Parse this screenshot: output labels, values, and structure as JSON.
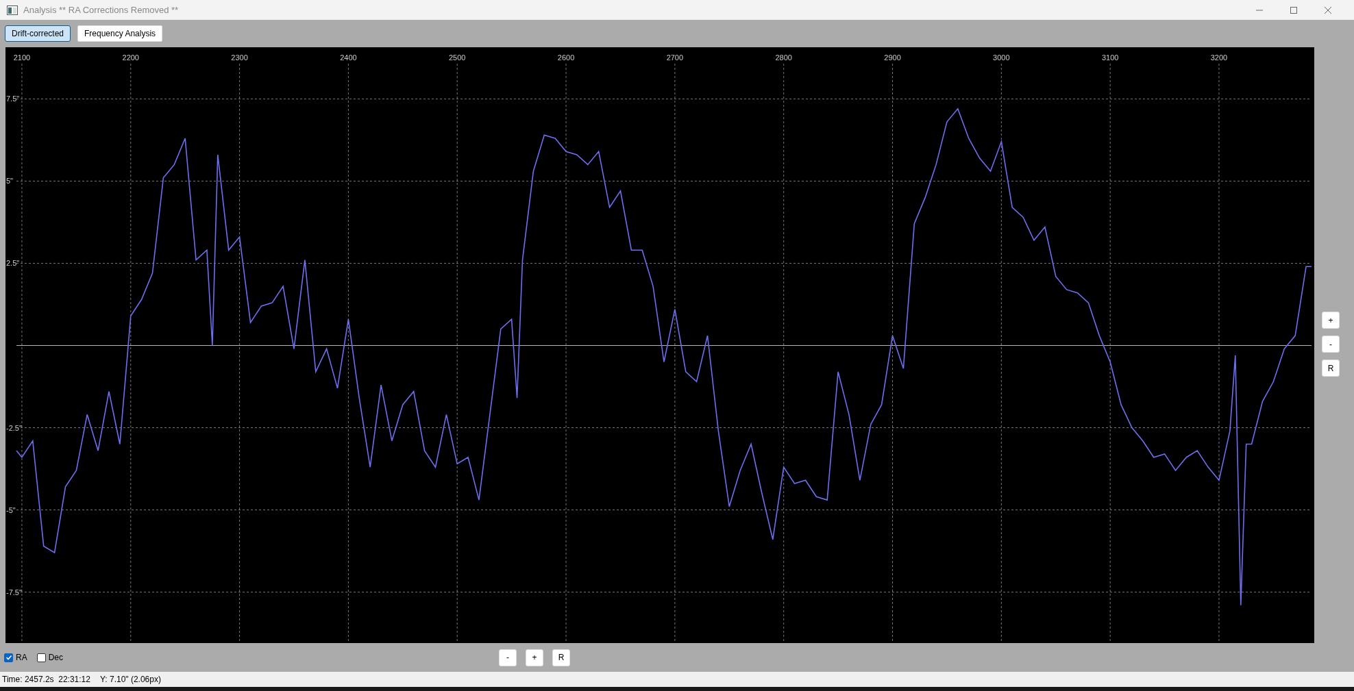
{
  "window": {
    "title": "Analysis ** RA Corrections Removed **"
  },
  "tabs": [
    {
      "label": "Drift-corrected",
      "selected": true
    },
    {
      "label": "Frequency Analysis",
      "selected": false
    }
  ],
  "chart": {
    "chart_data": {
      "type": "line",
      "grid": true,
      "xlim": [
        2095,
        3285
      ],
      "ylim": [
        -9.05,
        9.07
      ],
      "xticks": [
        2100,
        2200,
        2300,
        2400,
        2500,
        2600,
        2700,
        2800,
        2900,
        3000,
        3100,
        3200
      ],
      "yticks": [
        {
          "value": 7.5,
          "label": "7.5\""
        },
        {
          "value": 5,
          "label": "5\""
        },
        {
          "value": 2.5,
          "label": "2.5\""
        },
        {
          "value": -2.5,
          "label": "-2.5\""
        },
        {
          "value": -5,
          "label": "-5\""
        },
        {
          "value": -7.5,
          "label": "-7.5\""
        }
      ],
      "x": [
        2095,
        2100,
        2110,
        2120,
        2130,
        2140,
        2150,
        2160,
        2170,
        2180,
        2190,
        2200,
        2210,
        2220,
        2230,
        2240,
        2250,
        2260,
        2270,
        2275,
        2280,
        2290,
        2300,
        2310,
        2320,
        2330,
        2340,
        2350,
        2360,
        2370,
        2380,
        2390,
        2400,
        2410,
        2420,
        2430,
        2440,
        2450,
        2460,
        2470,
        2480,
        2490,
        2500,
        2510,
        2520,
        2530,
        2540,
        2550,
        2555,
        2560,
        2570,
        2580,
        2590,
        2600,
        2610,
        2620,
        2630,
        2640,
        2650,
        2660,
        2670,
        2680,
        2690,
        2700,
        2710,
        2720,
        2730,
        2740,
        2750,
        2760,
        2770,
        2780,
        2790,
        2800,
        2810,
        2820,
        2830,
        2840,
        2850,
        2860,
        2870,
        2880,
        2890,
        2900,
        2910,
        2920,
        2930,
        2940,
        2950,
        2960,
        2970,
        2980,
        2990,
        3000,
        3010,
        3020,
        3030,
        3040,
        3050,
        3060,
        3070,
        3080,
        3090,
        3100,
        3110,
        3120,
        3130,
        3140,
        3150,
        3160,
        3170,
        3180,
        3190,
        3200,
        3210,
        3215,
        3220,
        3225,
        3230,
        3240,
        3250,
        3260,
        3270,
        3280,
        3285
      ],
      "series": [
        {
          "color": "#6e6ef0",
          "values": [
            -3.2,
            -3.4,
            -2.9,
            -6.1,
            -6.3,
            -4.3,
            -3.8,
            -2.1,
            -3.2,
            -1.4,
            -3.0,
            0.9,
            1.4,
            2.2,
            5.1,
            5.5,
            6.3,
            2.6,
            2.9,
            0,
            5.8,
            2.9,
            3.3,
            0.7,
            1.2,
            1.3,
            1.8,
            -0.1,
            2.6,
            -0.8,
            -0.1,
            -1.3,
            0.8,
            -1.6,
            -3.7,
            -1.2,
            -2.9,
            -1.8,
            -1.4,
            -3.2,
            -3.7,
            -2.1,
            -3.6,
            -3.4,
            -4.7,
            -2.1,
            0.5,
            0.8,
            -1.6,
            2.6,
            5.3,
            6.4,
            6.3,
            5.9,
            5.8,
            5.5,
            5.9,
            4.2,
            4.7,
            2.9,
            2.9,
            1.8,
            -0.5,
            1.1,
            -0.8,
            -1.1,
            0.3,
            -2.6,
            -4.9,
            -3.8,
            -3.0,
            -4.5,
            -5.9,
            -3.7,
            -4.2,
            -4.1,
            -4.6,
            -4.7,
            -0.8,
            -2.1,
            -4.1,
            -2.4,
            -1.8,
            0.3,
            -0.7,
            3.7,
            4.5,
            5.5,
            6.8,
            7.2,
            6.3,
            5.7,
            5.3,
            6.2,
            4.2,
            3.9,
            3.2,
            3.6,
            2.1,
            1.7,
            1.6,
            1.3,
            0.3,
            -0.5,
            -1.8,
            -2.5,
            -2.9,
            -3.4,
            -3.3,
            -3.8,
            -3.4,
            -3.2,
            -3.7,
            -4.1,
            -2.6,
            -0.3,
            -7.9,
            -3.0,
            -3.0,
            -1.7,
            -1.1,
            -0.1,
            0.3,
            2.4,
            2.4
          ]
        }
      ]
    }
  },
  "zoom_side": [
    "+",
    "-",
    "R"
  ],
  "checkboxes": [
    {
      "label": "RA",
      "checked": true
    },
    {
      "label": "Dec",
      "checked": false
    }
  ],
  "zoom_bottom": [
    "-",
    "+",
    "R"
  ],
  "status_bar": {
    "time": "Time: 2457.2s  22:31:12",
    "y": "Y: 7.10\" (2.06px)"
  }
}
